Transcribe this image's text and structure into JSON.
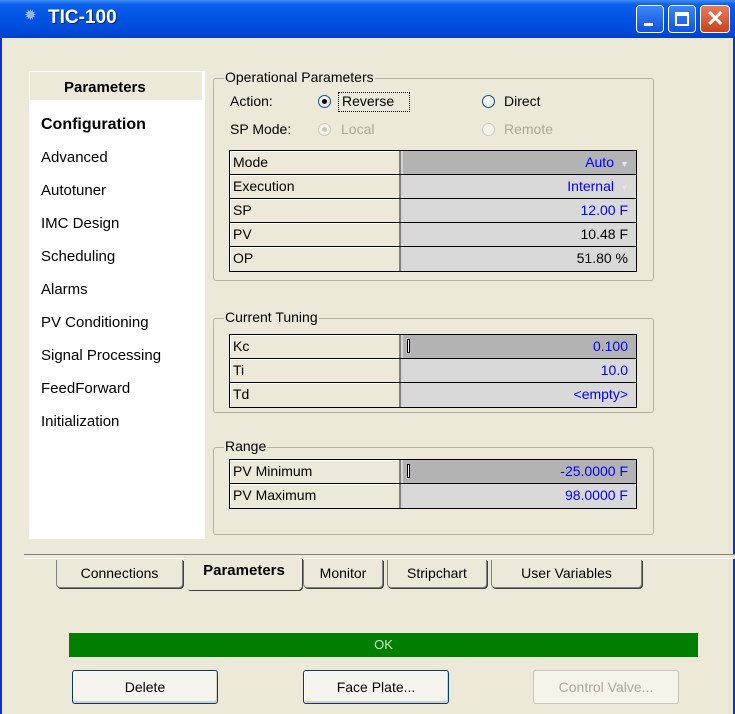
{
  "window": {
    "title": "TIC-100"
  },
  "sidebar": {
    "header": "Parameters",
    "items": [
      {
        "label": "Configuration",
        "active": true
      },
      {
        "label": "Advanced"
      },
      {
        "label": "Autotuner"
      },
      {
        "label": "IMC Design"
      },
      {
        "label": "Scheduling"
      },
      {
        "label": "Alarms"
      },
      {
        "label": "PV Conditioning"
      },
      {
        "label": "Signal Processing"
      },
      {
        "label": "FeedForward"
      },
      {
        "label": "Initialization"
      }
    ]
  },
  "operational": {
    "legend": "Operational Parameters",
    "action_label": "Action:",
    "reverse_label": "Reverse",
    "direct_label": "Direct",
    "action_selected": "Reverse",
    "spmode_label": "SP Mode:",
    "local_label": "Local",
    "remote_label": "Remote",
    "spmode_selected": "Local",
    "rows": [
      {
        "name": "Mode",
        "value": "Auto"
      },
      {
        "name": "Execution",
        "value": "Internal"
      },
      {
        "name": "SP",
        "value": "12.00 F"
      },
      {
        "name": "PV",
        "value": "10.48 F"
      },
      {
        "name": "OP",
        "value": "51.80 %"
      }
    ]
  },
  "tuning": {
    "legend": "Current Tuning",
    "rows": [
      {
        "name": "Kc",
        "value": "0.100"
      },
      {
        "name": "Ti",
        "value": "10.0"
      },
      {
        "name": "Td",
        "value": "<empty>"
      }
    ]
  },
  "range": {
    "legend": "Range",
    "rows": [
      {
        "name": "PV Minimum",
        "value": "-25.0000 F"
      },
      {
        "name": "PV Maximum",
        "value": "98.0000 F"
      }
    ]
  },
  "tabs": [
    {
      "label": "Connections"
    },
    {
      "label": "Parameters",
      "active": true
    },
    {
      "label": "Monitor"
    },
    {
      "label": "Stripchart"
    },
    {
      "label": "User Variables"
    }
  ],
  "status": {
    "text": "OK",
    "color": "#007f00"
  },
  "buttons": {
    "delete": "Delete",
    "faceplate": "Face Plate...",
    "control_valve": "Control Valve..."
  },
  "colors": {
    "titlebar": "#0154e3",
    "value_blue": "#0000ff"
  }
}
